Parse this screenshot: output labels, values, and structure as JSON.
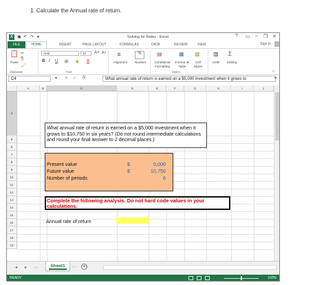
{
  "question": "1. Calculate the Annual rate of return.",
  "titlebar": {
    "app_icon": "X",
    "title": "Solving for Rates - Excel",
    "help": "?",
    "minimize": "–",
    "restore": "❐",
    "close": "✕"
  },
  "tabs": [
    "FILE",
    "HOME",
    "INSERT",
    "PAGE LAYOUT",
    "FORMULAS",
    "DATA",
    "REVIEW",
    "VIEW"
  ],
  "sign_in": "Sign In",
  "ribbon": {
    "paste": "Paste",
    "clipboard": "Clipboard",
    "font_name": "Arial",
    "font_size": "12",
    "bold": "B",
    "italic": "I",
    "underline": "U",
    "font_group": "Font",
    "alignment": "Alignment",
    "number": "Number",
    "percent": "%",
    "conditional_formatting": "Conditional Formatting",
    "format_as_table": "Format as Table",
    "cell_styles": "Cell Styles",
    "styles_group": "Styles",
    "cells": "Cells",
    "editing": "Editing"
  },
  "formula_bar": {
    "cell_ref": "C4",
    "fx": "fx",
    "formula": "What annual rate of return is earned on a $5,000 investment when it grows to"
  },
  "columns": [
    "A",
    "B",
    "C",
    "D",
    "E",
    "F",
    "G",
    "H",
    "I",
    "J"
  ],
  "rows": [
    "4",
    "5",
    "6",
    "7",
    "8",
    "9",
    "10",
    "11",
    "12",
    "13",
    "14",
    "15",
    "16",
    "17",
    "18",
    "19"
  ],
  "question_cell": "What annual rate of return is earned on a $5,000 investment when it grows to $10,750 in six years? (Do not round intermediate calculations and round your final answer to 2 decimal places.)",
  "inputs": [
    {
      "label": "Present value",
      "dollar": "$",
      "value": "5,000"
    },
    {
      "label": "Future value",
      "dollar": "$",
      "value": "10,750"
    },
    {
      "label": "Number of periods",
      "dollar": "",
      "value": "6"
    }
  ],
  "instruction": "Complete the following analysis. Do not hard code values in your calculations.",
  "answer_label": "Annual rate of return",
  "answer_value": "",
  "sheet_tab": "Sheet1",
  "sheet_nav_prev": "◂",
  "sheet_nav_next": "▸",
  "sheet_nav_more": "...",
  "status": "READY",
  "zoom": "100%",
  "colors": {
    "excel_green": "#217346",
    "input_fill": "#fbbf8f",
    "answer_fill": "#ffff66",
    "instruction_red": "#e00000",
    "value_blue": "#1f5fbf"
  }
}
